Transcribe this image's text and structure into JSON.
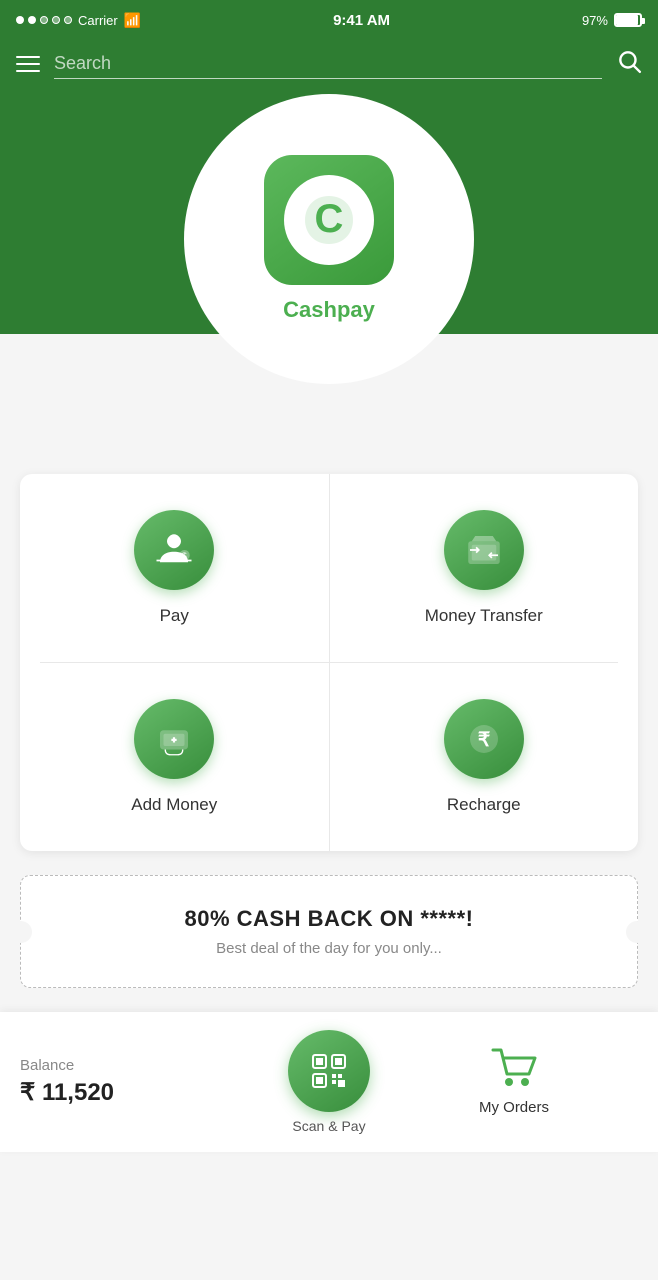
{
  "statusBar": {
    "carrier": "Carrier",
    "time": "9:41 AM",
    "battery": "97%"
  },
  "searchBar": {
    "placeholder": "Search"
  },
  "hero": {
    "brandName": "Cashpay"
  },
  "gridActions": [
    {
      "id": "pay",
      "label": "Pay",
      "icon": "hand-money"
    },
    {
      "id": "money-transfer",
      "label": "Money Transfer",
      "icon": "bank-transfer"
    },
    {
      "id": "add-money",
      "label": "Add Money",
      "icon": "wallet"
    },
    {
      "id": "recharge",
      "label": "Recharge",
      "icon": "rupee"
    }
  ],
  "promoBanner": {
    "title": "80% CASH BACK ON *****!",
    "subtitle": "Best deal of the day for you only..."
  },
  "bottomBar": {
    "balanceLabel": "Balance",
    "balanceAmount": "₹ 11,520",
    "scanLabel": "Scan & Pay",
    "myOrdersLabel": "My Orders"
  }
}
